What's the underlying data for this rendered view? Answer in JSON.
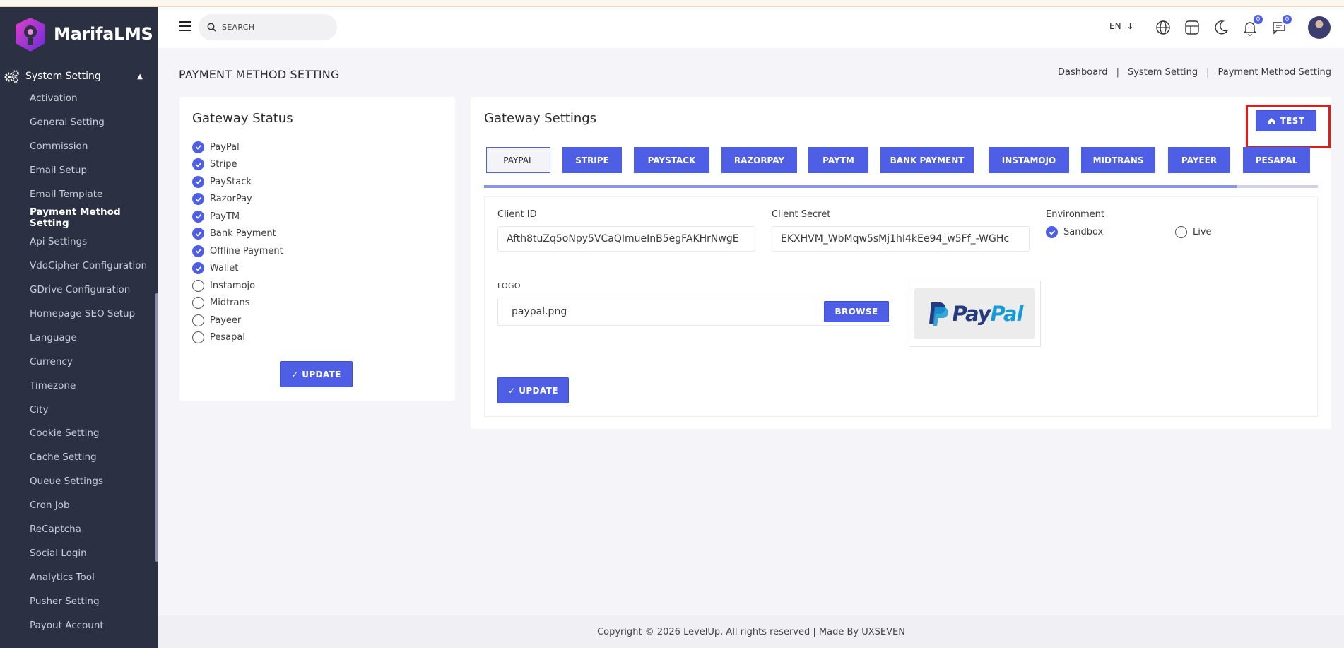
{
  "app": {
    "brand": "MarifaLMS"
  },
  "sidebar": {
    "group_label": "System Setting",
    "items": [
      {
        "label": "Activation"
      },
      {
        "label": "General Setting"
      },
      {
        "label": "Commission"
      },
      {
        "label": "Email Setup"
      },
      {
        "label": "Email Template"
      },
      {
        "label": "Payment Method Setting",
        "active": true
      },
      {
        "label": "Api Settings"
      },
      {
        "label": "VdoCipher Configuration"
      },
      {
        "label": "GDrive Configuration"
      },
      {
        "label": "Homepage SEO Setup"
      },
      {
        "label": "Language"
      },
      {
        "label": "Currency"
      },
      {
        "label": "Timezone"
      },
      {
        "label": "City"
      },
      {
        "label": "Cookie Setting"
      },
      {
        "label": "Cache Setting"
      },
      {
        "label": "Queue Settings"
      },
      {
        "label": "Cron Job"
      },
      {
        "label": "ReCaptcha"
      },
      {
        "label": "Social Login"
      },
      {
        "label": "Analytics Tool"
      },
      {
        "label": "Pusher Setting"
      },
      {
        "label": "Payout Account"
      }
    ]
  },
  "header": {
    "search_placeholder": "SEARCH",
    "language": "EN",
    "notification_count": "0",
    "message_count": "0"
  },
  "page": {
    "title": "PAYMENT METHOD SETTING",
    "breadcrumb": [
      "Dashboard",
      "System Setting",
      "Payment Method Setting"
    ],
    "breadcrumb_sep": "|"
  },
  "gateway_status": {
    "title": "Gateway Status",
    "items": [
      {
        "label": "PayPal",
        "checked": true
      },
      {
        "label": "Stripe",
        "checked": true
      },
      {
        "label": "PayStack",
        "checked": true
      },
      {
        "label": "RazorPay",
        "checked": true
      },
      {
        "label": "PayTM",
        "checked": true
      },
      {
        "label": "Bank Payment",
        "checked": true
      },
      {
        "label": "Offline Payment",
        "checked": true
      },
      {
        "label": "Wallet",
        "checked": true
      },
      {
        "label": "Instamojo",
        "checked": false
      },
      {
        "label": "Midtrans",
        "checked": false
      },
      {
        "label": "Payeer",
        "checked": false
      },
      {
        "label": "Pesapal",
        "checked": false
      }
    ],
    "update_label": "✓ UPDATE"
  },
  "gateway_settings": {
    "title": "Gateway Settings",
    "test_label": "TEST",
    "tabs": [
      "PAYPAL",
      "STRIPE",
      "PAYSTACK",
      "RAZORPAY",
      "PAYTM",
      "BANK PAYMENT",
      "INSTAMOJO",
      "MIDTRANS",
      "PAYEER",
      "PESAPAL"
    ],
    "active_tab": "PAYPAL",
    "client_id_label": "Client ID",
    "client_id_value": "Afth8tuZq5oNpy5VCaQImueInB5egFAKHrNwgE",
    "client_secret_label": "Client Secret",
    "client_secret_value": "EKXHVM_WbMqw5sMj1hI4kEe94_w5Ff_-WGHc",
    "environment_label": "Environment",
    "env_sandbox": "Sandbox",
    "env_live": "Live",
    "env_selected": "Sandbox",
    "logo_label": "LOGO",
    "logo_file": "paypal.png",
    "browse_label": "BROWSE",
    "logo_word_1": "Pay",
    "logo_word_2": "Pal",
    "update_label": "✓ UPDATE"
  },
  "footer": {
    "text": "Copyright © 2026 LevelUp. All rights reserved | Made By UXSEVEN"
  },
  "colors": {
    "accent": "#4e5fe6",
    "sidebar": "#2b3043",
    "highlight": "#e21b1b"
  }
}
